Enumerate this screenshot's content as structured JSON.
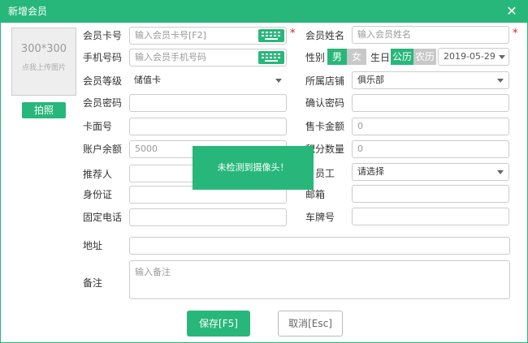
{
  "dialog": {
    "title": "新增会员",
    "close_label": "✕"
  },
  "photo": {
    "size_text": "300*300",
    "hint_text": "点我上传图片",
    "button_label": "拍照"
  },
  "left_fields": {
    "card_no": {
      "label": "会员卡号",
      "placeholder": "输入会员卡号[F2]"
    },
    "phone": {
      "label": "手机号码",
      "placeholder": "输入会员手机号码"
    },
    "level": {
      "label": "会员等级",
      "value": "储值卡"
    },
    "password": {
      "label": "会员密码",
      "value": ""
    },
    "face_no": {
      "label": "卡面号",
      "value": ""
    },
    "balance": {
      "label": "账户余额",
      "value": "5000"
    },
    "referrer": {
      "label": "推荐人",
      "value": ""
    },
    "id_card": {
      "label": "身份证",
      "value": ""
    },
    "landline": {
      "label": "固定电话",
      "value": ""
    }
  },
  "right_fields": {
    "name": {
      "label": "会员姓名",
      "placeholder": "输入会员姓名"
    },
    "gender": {
      "label": "性别",
      "male": "男",
      "female": "女"
    },
    "birthday": {
      "label": "生日",
      "solar": "公历",
      "lunar": "农历",
      "date": "2019-05-29"
    },
    "store": {
      "label": "所属店铺",
      "value": "俱乐部"
    },
    "confirm_password": {
      "label": "确认密码",
      "value": ""
    },
    "sale_amount": {
      "label": "售卡金额",
      "value": "0"
    },
    "points": {
      "label": "积分数量",
      "value": "0"
    },
    "staff": {
      "label": "员工",
      "value": "请选择"
    },
    "email": {
      "label": "邮箱",
      "value": ""
    },
    "plate": {
      "label": "车牌号",
      "value": ""
    }
  },
  "address": {
    "label": "地址",
    "value": ""
  },
  "remark": {
    "label": "备注",
    "placeholder": "输入备注"
  },
  "toast": {
    "message": "未检测到摄像头！"
  },
  "buttons": {
    "save": "保存[F5]",
    "cancel": "取消[Esc]"
  },
  "required_mark": "*",
  "colors": {
    "accent": "#28b77a",
    "required": "#e02020",
    "toggle_off": "#c8c8c8"
  }
}
